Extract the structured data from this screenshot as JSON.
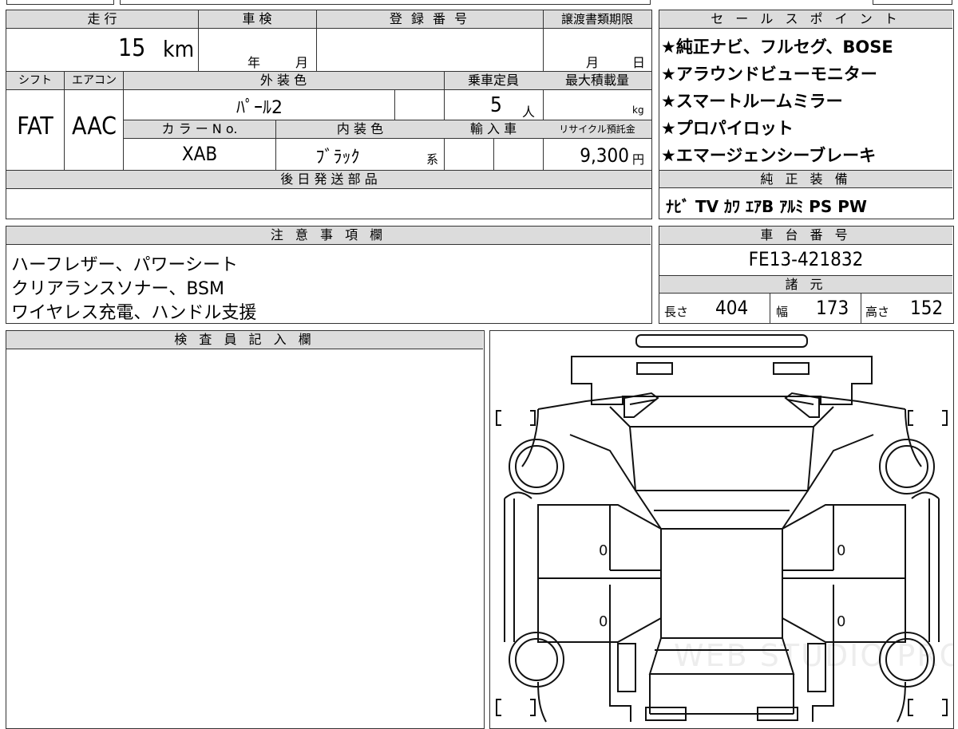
{
  "main_info": {
    "mileage_label": "走 行",
    "mileage_value": "15",
    "mileage_unit": "km",
    "inspection_label": "車 検",
    "inspection_year_unit": "年",
    "inspection_month_unit": "月",
    "registration_label": "登 録 番 号",
    "transfer_label": "譲渡書類期限",
    "transfer_month_unit": "月",
    "transfer_day_unit": "日",
    "shift_label": "シフト",
    "shift_value": "FAT",
    "aircon_label": "エアコン",
    "aircon_value": "AAC",
    "exterior_color_label": "外 装 色",
    "exterior_color_value": "ﾊﾟｰﾙ2",
    "capacity_label": "乗車定員",
    "capacity_value": "5",
    "capacity_unit": "人",
    "max_load_label": "最大積載量",
    "max_load_unit": "kg",
    "color_no_label": "カ ラ ー N o.",
    "color_no_value": "XAB",
    "interior_color_label": "内 装 色",
    "interior_color_value": "ﾌﾞﾗｯｸ",
    "interior_color_suffix": "系",
    "import_label": "輸 入 車",
    "recycle_label": "リサイクル預託金",
    "recycle_value": "9,300",
    "recycle_unit": "円",
    "later_parts_label": "後 日 発 送 部 品"
  },
  "sales_points": {
    "label": "セ ー ル ス ポ イ ン ト",
    "items": [
      "★純正ナビ、フルセグ、BOSE",
      "★アラウンドビューモニター",
      "★スマートルームミラー",
      "★プロパイロット",
      "★エマージェンシーブレーキ"
    ]
  },
  "equipment": {
    "label": "純 正 装 備",
    "value": "ﾅﾋﾞ TV ｶﾜ ｴｱB ｱﾙﾐ PS PW"
  },
  "notes": {
    "label": "注 意 事 項 欄",
    "lines": [
      "ハーフレザー、パワーシート",
      "クリアランスソナー、BSM",
      "ワイヤレス充電、ハンドル支援"
    ]
  },
  "chassis": {
    "label": "車 台 番 号",
    "value": "FE13-421832"
  },
  "specs": {
    "label": "諸 元",
    "length_label": "長さ",
    "length_value": "404",
    "width_label": "幅",
    "width_value": "173",
    "height_label": "高さ",
    "height_value": "152"
  },
  "inspector": {
    "label": "検 査 員 記 入 欄"
  },
  "diagram": {
    "door_mark": "0",
    "watermark": "WEB STUDIO PRO"
  }
}
